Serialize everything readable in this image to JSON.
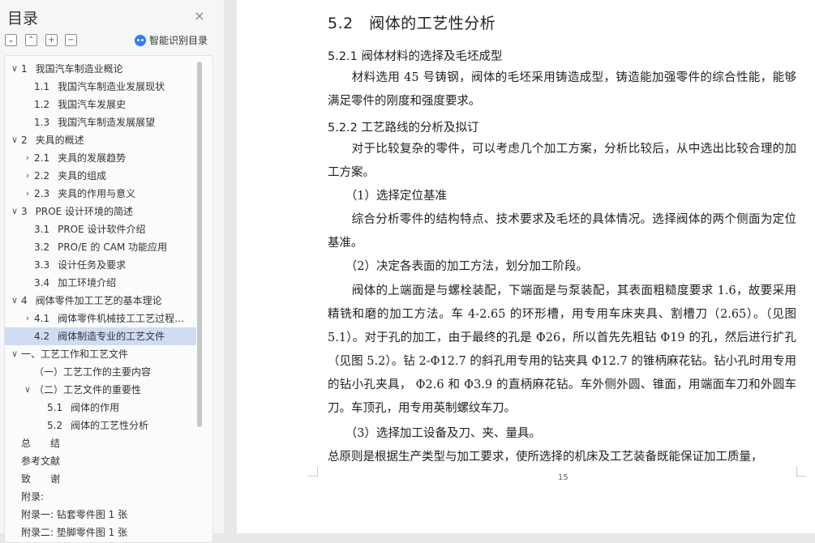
{
  "sidebar": {
    "title": "目录",
    "close": "×",
    "smart_toc": "智能识别目录",
    "toc": [
      {
        "num": "1",
        "text": "我国汽车制造业概论",
        "level": 0,
        "toggle": "expanded"
      },
      {
        "num": "1.1",
        "text": "我国汽车制造业发展现状",
        "level": 1,
        "toggle": "none"
      },
      {
        "num": "1.2",
        "text": "我国汽车发展史",
        "level": 1,
        "toggle": "none"
      },
      {
        "num": "1.3",
        "text": "我国汽车制造发展展望",
        "level": 1,
        "toggle": "none"
      },
      {
        "num": "2",
        "text": "夹具的概述",
        "level": 0,
        "toggle": "expanded"
      },
      {
        "num": "2.1",
        "text": "夹具的发展趋势",
        "level": 1,
        "toggle": "collapsed"
      },
      {
        "num": "2.2",
        "text": "夹具的组成",
        "level": 1,
        "toggle": "collapsed"
      },
      {
        "num": "2.3",
        "text": "夹具的作用与意义",
        "level": 1,
        "toggle": "collapsed"
      },
      {
        "num": "3",
        "text": "PROE 设计环境的简述",
        "level": 0,
        "toggle": "expanded"
      },
      {
        "num": "3.1",
        "text": "PROE 设计软件介绍",
        "level": 1,
        "toggle": "none"
      },
      {
        "num": "3.2",
        "text": "PRO/E 的 CAM 功能应用",
        "level": 1,
        "toggle": "none"
      },
      {
        "num": "3.3",
        "text": "设计任务及要求",
        "level": 1,
        "toggle": "none"
      },
      {
        "num": "3.4",
        "text": "加工环境介绍",
        "level": 1,
        "toggle": "none"
      },
      {
        "num": "4",
        "text": "阀体零件加工工艺的基本理论",
        "level": 0,
        "toggle": "expanded"
      },
      {
        "num": "4.1",
        "text": "阀体零件机械技工工艺过程分析",
        "level": 1,
        "toggle": "collapsed"
      },
      {
        "num": "4.2",
        "text": "阀体制造专业的工艺文件",
        "level": 1,
        "toggle": "none",
        "active": true
      },
      {
        "num": "",
        "text": "一、工艺工作和工艺文件",
        "level": 0,
        "toggle": "expanded"
      },
      {
        "num": "",
        "text": "（一）工艺工作的主要内容",
        "level": 1,
        "toggle": "none"
      },
      {
        "num": "",
        "text": "（二）工艺文件的重要性",
        "level": 1,
        "toggle": "expanded"
      },
      {
        "num": "5.1",
        "text": "阀体的作用",
        "level": 2,
        "toggle": "none"
      },
      {
        "num": "5.2",
        "text": "阀体的工艺性分析",
        "level": 2,
        "toggle": "none"
      },
      {
        "num": "",
        "text": "总　　结",
        "level": 0,
        "toggle": "none"
      },
      {
        "num": "",
        "text": "参考文献",
        "level": 0,
        "toggle": "none"
      },
      {
        "num": "",
        "text": "致　　谢",
        "level": 0,
        "toggle": "none"
      },
      {
        "num": "",
        "text": "附录:",
        "level": 0,
        "toggle": "none"
      },
      {
        "num": "",
        "text": "附录一: 钻套零件图 1 张",
        "level": 0,
        "toggle": "none"
      },
      {
        "num": "",
        "text": "附录二: 垫脚零件图 1 张",
        "level": 0,
        "toggle": "none"
      }
    ]
  },
  "doc": {
    "heading": "5.2　阀体的工艺性分析",
    "s1": "5.2.1 阀体材料的选择及毛坯成型",
    "p1": "　　材料选用 45 号铸钢，阀体的毛坯采用铸造成型，铸造能加强零件的综合性能，能够满足零件的刚度和强度要求。",
    "s2": "5.2.2 工艺路线的分析及拟订",
    "p2": "　　对于比较复杂的零件，可以考虑几个加工方案，分析比较后，从中选出比较合理的加工方案。",
    "p3": "　　（1）选择定位基准",
    "p4": "　　综合分析零件的结构特点、技术要求及毛坯的具体情况。选择阀体的两个侧面为定位基准。",
    "p5": "　　（2）决定各表面的加工方法，划分加工阶段。",
    "p6": "　　阀体的上端面是与螺栓装配，下端面是与泵装配，其表面粗糙度要求 1.6，故要采用精铣和磨的加工方法。车 4-2.65 的环形槽，用专用车床夹具、割槽刀（2.65）。（见图 5.1）。对于孔的加工，由于最终的孔是 Φ26，所以首先先粗钻 Φ19 的孔，然后进行扩孔（见图 5.2）。钻 2-Φ12.7 的斜孔用专用的钻夹具 Φ12.7 的锥柄麻花钻。钻小孔时用专用的钻小孔夹具， Φ2.6 和 Φ3.9 的直柄麻花钻。车外侧外圆、锥面，用端面车刀和外圆车刀。车顶孔，用专用英制螺纹车刀。",
    "p7": "　　（3）选择加工设备及刀、夹、量具。",
    "p8": "总原则是根据生产类型与加工要求，使所选择的机床及工艺装备既能保证加工质量，",
    "page_number": "15"
  }
}
